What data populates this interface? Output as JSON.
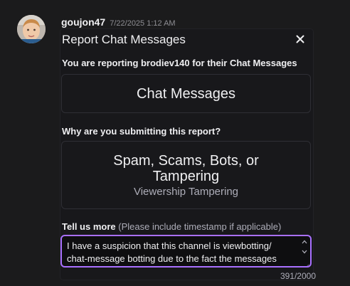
{
  "message": {
    "username": "goujon47",
    "timestamp": "7/22/2025 1:12 AM"
  },
  "report": {
    "title": "Report Chat Messages",
    "reporting_label": "You are reporting brodiev140 for their Chat Messages",
    "category_value": "Chat Messages",
    "why_label": "Why are you submitting this report?",
    "reason_main": "Spam, Scams, Bots, or Tampering",
    "reason_sub": "Viewership Tampering",
    "tell_more_label": "Tell us more",
    "tell_more_hint": "(Please include timestamp if applicable)",
    "details_text": "I have a suspicion that this channel is viewbotting/\nchat-message botting due to the fact the messages",
    "char_count": "391/2000"
  },
  "colors": {
    "accent": "#a970ff",
    "background": "#18181b"
  },
  "icons": {
    "close": "close-icon",
    "scroll_up": "chevron-up-icon",
    "scroll_down": "chevron-down-icon",
    "resize": "resize-grip-icon"
  }
}
